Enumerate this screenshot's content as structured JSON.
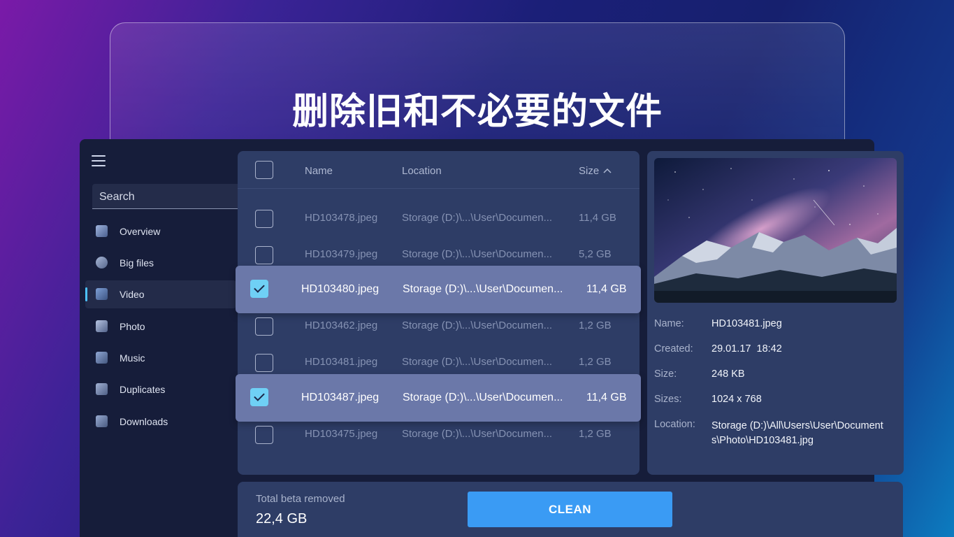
{
  "headline": "删除旧和不必要的文件",
  "search": {
    "placeholder": "Search"
  },
  "sidebar": {
    "items": [
      {
        "label": "Overview",
        "icon": "monitor-icon",
        "active": false
      },
      {
        "label": "Big files",
        "icon": "weight-icon",
        "active": false
      },
      {
        "label": "Video",
        "icon": "clapperboard-icon",
        "active": true
      },
      {
        "label": "Photo",
        "icon": "image-icon",
        "active": false
      },
      {
        "label": "Music",
        "icon": "music-note-icon",
        "active": false
      },
      {
        "label": "Duplicates",
        "icon": "stack-icon",
        "active": false
      },
      {
        "label": "Downloads",
        "icon": "download-tray-icon",
        "active": false
      }
    ]
  },
  "file_list": {
    "columns": {
      "name": "Name",
      "location": "Location",
      "size": "Size"
    },
    "sort": {
      "column": "size",
      "direction": "ascending"
    },
    "rows": [
      {
        "name": "HD103478.jpeg",
        "location": "Storage (D:)\\...\\User\\Documen...",
        "size": "11,4 GB",
        "checked": false
      },
      {
        "name": "HD103479.jpeg",
        "location": "Storage (D:)\\...\\User\\Documen...",
        "size": "5,2 GB",
        "checked": false
      },
      {
        "name": "HD103480.jpeg",
        "location": "Storage (D:)\\...\\User\\Documen...",
        "size": "11,4 GB",
        "checked": true
      },
      {
        "name": "HD103462.jpeg",
        "location": "Storage (D:)\\...\\User\\Documen...",
        "size": "1,2 GB",
        "checked": false
      },
      {
        "name": "HD103481.jpeg",
        "location": "Storage (D:)\\...\\User\\Documen...",
        "size": "1,2 GB",
        "checked": false
      },
      {
        "name": "HD103487.jpeg",
        "location": "Storage (D:)\\...\\User\\Documen...",
        "size": "11,4 GB",
        "checked": true
      },
      {
        "name": "HD103475.jpeg",
        "location": "Storage (D:)\\...\\User\\Documen...",
        "size": "1,2 GB",
        "checked": false
      }
    ]
  },
  "details": {
    "name_label": "Name:",
    "name_value": "HD103481.jpeg",
    "created_label": "Created:",
    "created_value": "29.01.17  18:42",
    "size_label": "Size:",
    "size_value": "248 KB",
    "sizes_label": "Sizes:",
    "sizes_value": "1024 x 768",
    "location_label": "Location:",
    "location_value": "Storage (D:)\\All\\Users\\User\\Documents\\Photo\\HD103481.jpg"
  },
  "footer": {
    "total_label": "Total beta removed",
    "total_value": "22,4 GB",
    "clean_label": "CLEAN"
  },
  "colors": {
    "accent": "#3a9bf4",
    "checkbox_checked": "#6fd0f5",
    "selected_row": "#6b78a9",
    "panel": "#2e3d66",
    "app_background": "#161d3a"
  }
}
